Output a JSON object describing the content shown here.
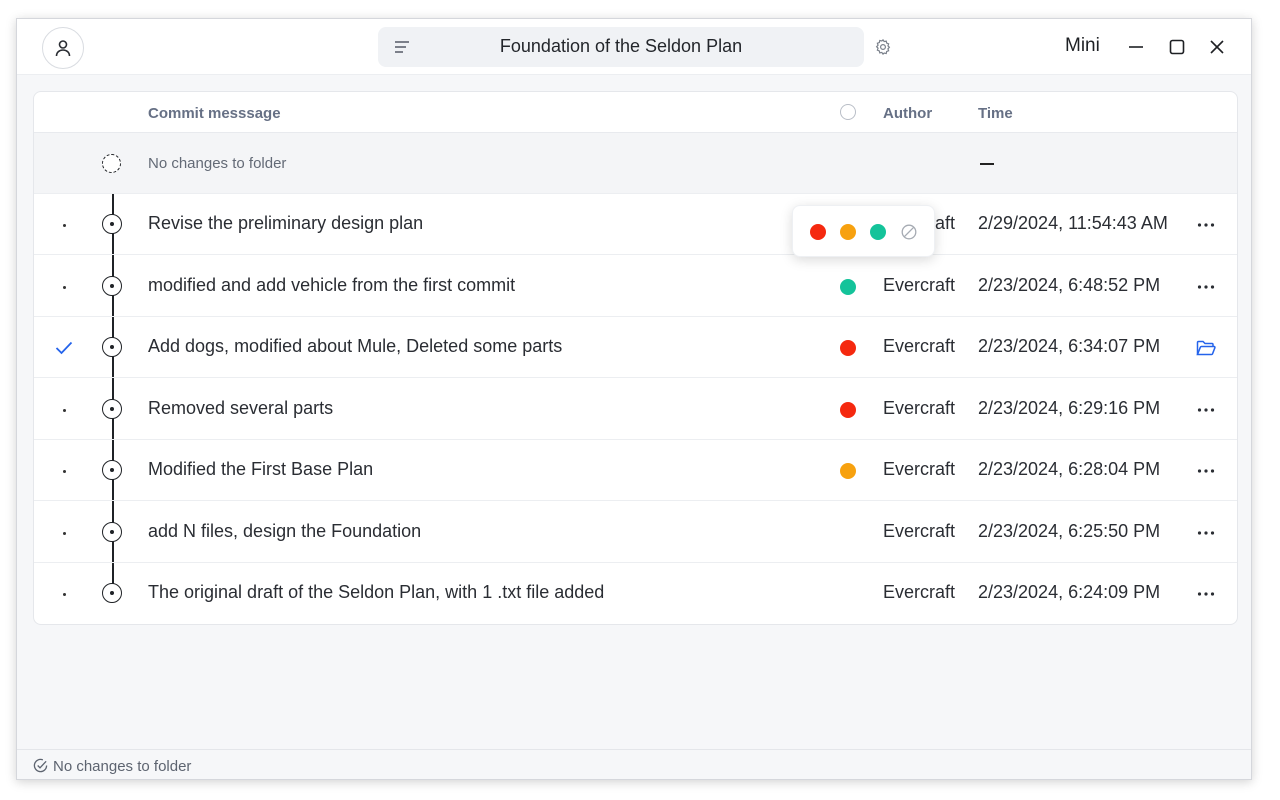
{
  "window": {
    "title": "Foundation of the Seldon Plan",
    "mini_label": "Mini"
  },
  "table": {
    "headers": {
      "message": "Commit messsage",
      "author": "Author",
      "time": "Time"
    },
    "working_row": {
      "message": "No changes to folder",
      "time": "—"
    },
    "commits": [
      {
        "message": "Revise the preliminary design plan",
        "author": "Evercraft",
        "time": "2/29/2024, 11:54:43 AM",
        "tag_color": "",
        "checked": false
      },
      {
        "message": "modified and add vehicle from the first commit",
        "author": "Evercraft",
        "time": "2/23/2024, 6:48:52 PM",
        "tag_color": "#14c39a",
        "checked": false
      },
      {
        "message": "Add dogs, modified about Mule, Deleted some parts",
        "author": "Evercraft",
        "time": "2/23/2024, 6:34:07 PM",
        "tag_color": "#f5290f",
        "checked": true
      },
      {
        "message": "Removed several parts",
        "author": "Evercraft",
        "time": "2/23/2024, 6:29:16 PM",
        "tag_color": "#f5290f",
        "checked": false
      },
      {
        "message": "Modified the First Base Plan",
        "author": "Evercraft",
        "time": "2/23/2024, 6:28:04 PM",
        "tag_color": "#f7a10f",
        "checked": false
      },
      {
        "message": "add N files, design the Foundation",
        "author": "Evercraft",
        "time": "2/23/2024, 6:25:50 PM",
        "tag_color": "",
        "checked": false
      },
      {
        "message": "The original draft of the Seldon Plan, with 1 .txt file added",
        "author": "Evercraft",
        "time": "2/23/2024, 6:24:09 PM",
        "tag_color": "",
        "checked": false
      }
    ]
  },
  "color_picker": {
    "colors": [
      "#f5290f",
      "#f7a10f",
      "#14c39a"
    ],
    "none_icon": "no-color-icon"
  },
  "status": {
    "text": "No changes to folder",
    "icon": "check-circle-icon"
  },
  "accent": "#2463eb"
}
